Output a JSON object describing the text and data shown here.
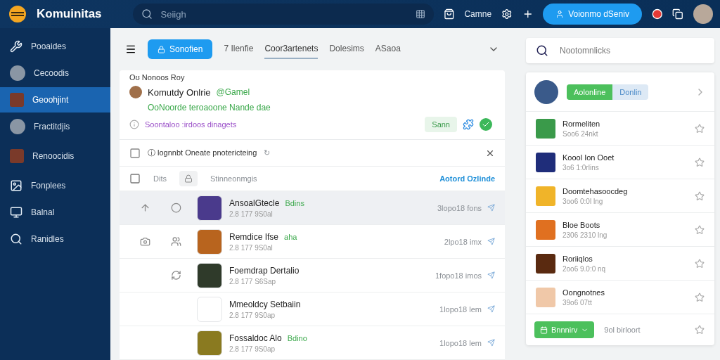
{
  "header": {
    "brand": "Komuinitas",
    "search": {
      "placeholder": "Seiigh"
    },
    "shop_label": "Camne",
    "cta": "Voionmo dSeniv"
  },
  "sidebar": {
    "items": [
      {
        "label": "Pooaides",
        "kind": "icon",
        "selected": false
      },
      {
        "label": "Cecoodis",
        "kind": "avatar",
        "selected": false
      },
      {
        "label": "Geoohjint",
        "kind": "thumb",
        "selected": true
      },
      {
        "label": "Fractitdjis",
        "kind": "avatar",
        "selected": false
      },
      {
        "label": "Renoocidis",
        "kind": "thumb",
        "selected": false
      },
      {
        "label": "Fonplees",
        "kind": "icon",
        "selected": false
      },
      {
        "label": "Balnal",
        "kind": "icon",
        "selected": false
      },
      {
        "label": "Ranidles",
        "kind": "icon",
        "selected": false
      }
    ]
  },
  "toolbar": {
    "primary": "Sonofien",
    "tabs": [
      {
        "label": "7 Ilenfie",
        "selected": false
      },
      {
        "label": "Coor3artenets",
        "selected": true
      },
      {
        "label": "Dolesims",
        "selected": false
      },
      {
        "label": "ASaoa",
        "selected": false
      }
    ]
  },
  "post": {
    "heading": "Oʊ  Nonoos Roy",
    "author": "Komutdy Onlrie",
    "handle": "@Gamel",
    "subtitle": "OoNoorde teroaoone Nande dae",
    "link": "Soontaloo :irdoos dinagets",
    "action": "Sann"
  },
  "notice": {
    "text": "ⓘ lognnbt Oneate pnotericteing",
    "hint": "↻"
  },
  "list": {
    "select_all": false,
    "column_1": "Dits",
    "column_2": "Stinneonmgis",
    "link": "Aotord Ozlinde",
    "rows": [
      {
        "name": "AnsoalGtecle",
        "tag": "Bdins",
        "meta": "2.8  177 9S0al",
        "time": "3lopo18 fons",
        "lead": [
          {
            "kind": "up"
          },
          {
            "kind": "badge"
          }
        ],
        "selected": true
      },
      {
        "name": "Remdice Ifse",
        "tag": "aha",
        "meta": "2.8  177 9S0al",
        "time": "2lpo18 imx",
        "lead": [
          {
            "kind": "camera"
          },
          {
            "kind": "users"
          }
        ],
        "selected": false
      },
      {
        "name": "Foemdrap Dertalio",
        "meta": "2.8  177 S6Sap",
        "time": "1fopo18 imos",
        "lead": [
          {
            "kind": "none"
          },
          {
            "kind": "refresh"
          }
        ],
        "selected": false
      },
      {
        "name": "Mmeoldcy Setbaiin",
        "meta": "2.8  177 9S0ap",
        "time": "1lopo18 lem",
        "selected": false
      },
      {
        "name": "Fossaldoc Alo",
        "tag": "Bdino",
        "meta": "2.8  177 9S0ap",
        "time": "1lopo18 lem",
        "selected": false
      }
    ]
  },
  "right": {
    "search": {
      "placeholder": "Nootomnlicks"
    },
    "segments": [
      {
        "label": "Aolonline",
        "selected": true
      },
      {
        "label": "Donlin",
        "selected": false
      }
    ],
    "items": [
      {
        "title": "Rormeliten",
        "subtitle": "Soo6 24nkt",
        "color": "#3a9a4a"
      },
      {
        "title": "Koool Ion Ooet",
        "subtitle": "3o6 1:0rlins",
        "color": "#1f2d7a"
      },
      {
        "title": "Doomtehasoocdeg",
        "subtitle": "3oo6 0:0l lng",
        "color": "#f0b429"
      },
      {
        "title": "Bloe Boots",
        "subtitle": "2306 2310 lng",
        "color": "#e07020"
      },
      {
        "title": "Roriiqlos",
        "subtitle": "2oo6 9.0:0 nq",
        "color": "#5a2a10"
      },
      {
        "title": "Oongnotnes",
        "subtitle": "39o6 07tt",
        "color": "#f0c8a8"
      }
    ],
    "footer_button": "Bnnnirv",
    "footer_text": "9ol birloort"
  }
}
